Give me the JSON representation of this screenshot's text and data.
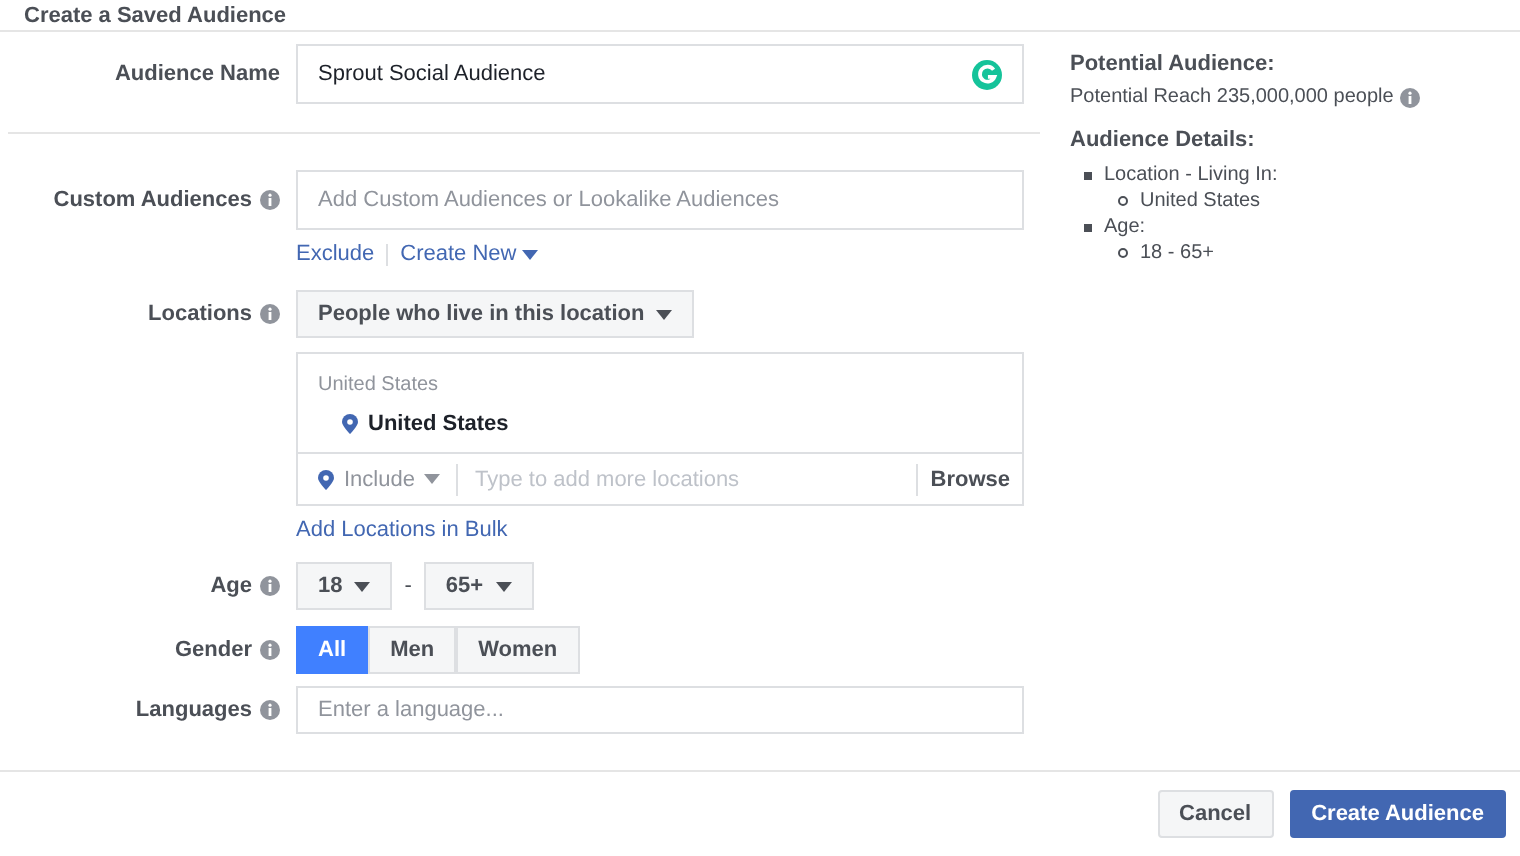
{
  "title": "Create a Saved Audience",
  "audience_name": {
    "label": "Audience Name",
    "value": "Sprout Social Audience"
  },
  "custom_audiences": {
    "label": "Custom Audiences",
    "placeholder": "Add Custom Audiences or Lookalike Audiences",
    "links": [
      {
        "label": "Exclude",
        "kind": "plain"
      },
      {
        "label": "Create New",
        "kind": "dropdown"
      }
    ]
  },
  "locations": {
    "label": "Locations",
    "type_dropdown": "People who live in this location",
    "group_heading": "United States",
    "items": [
      "United States"
    ],
    "include_dropdown": "Include",
    "placeholder": "Type to add more locations",
    "browse": "Browse",
    "bulk_link": "Add Locations in Bulk"
  },
  "age": {
    "label": "Age",
    "from": "18",
    "separator": "-",
    "to": "65+"
  },
  "gender": {
    "label": "Gender",
    "options": [
      {
        "label": "All",
        "selected": true
      },
      {
        "label": "Men",
        "selected": false
      },
      {
        "label": "Women",
        "selected": false
      }
    ]
  },
  "languages": {
    "label": "Languages",
    "placeholder": "Enter a language..."
  },
  "summary": {
    "heading": "Potential Audience:",
    "reach": "Potential Reach 235,000,000 people",
    "details_heading": "Audience Details:",
    "details": [
      {
        "text": "Location - Living In:",
        "children": [
          {
            "text": "United States"
          }
        ]
      },
      {
        "text": "Age:",
        "children": [
          {
            "text": "18 - 65+"
          }
        ]
      }
    ]
  },
  "buttons": [
    {
      "label": "Cancel",
      "kind": "secondary"
    },
    {
      "label": "Create Audience",
      "kind": "primary"
    }
  ]
}
